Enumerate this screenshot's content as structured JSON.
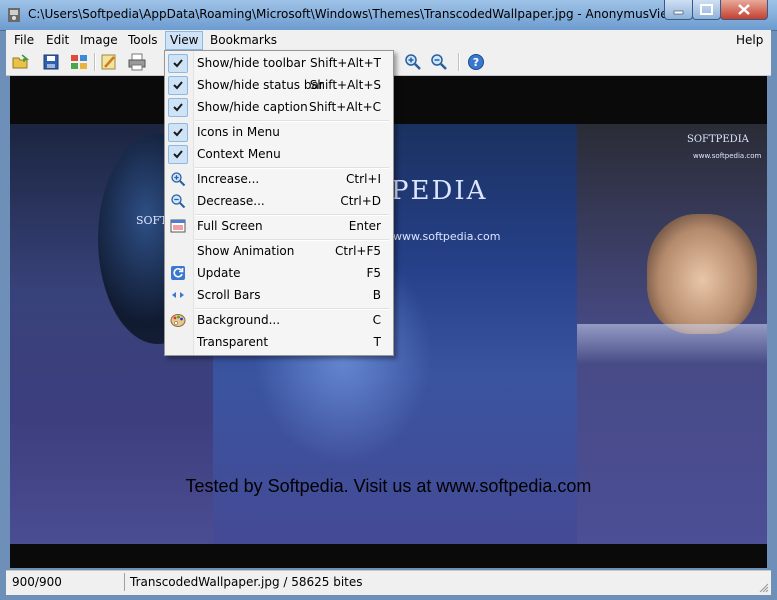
{
  "window": {
    "title": "C:\\Users\\Softpedia\\AppData\\Roaming\\Microsoft\\Windows\\Themes\\TranscodedWallpaper.jpg - AnonymusViewer"
  },
  "menubar": {
    "file": "File",
    "edit": "Edit",
    "image": "Image",
    "tools": "Tools",
    "view": "View",
    "bookmarks": "Bookmarks",
    "help": "Help"
  },
  "view_menu": {
    "items": [
      {
        "label": "Show/hide toolbar",
        "shortcut": "Shift+Alt+T",
        "checked": true
      },
      {
        "label": "Show/hide status bar",
        "shortcut": "Shift+Alt+S",
        "checked": true
      },
      {
        "label": "Show/hide caption",
        "shortcut": "Shift+Alt+C",
        "checked": true
      },
      {
        "label": "Icons in Menu",
        "shortcut": "",
        "checked": true
      },
      {
        "label": "Context Menu",
        "shortcut": "",
        "checked": true
      },
      {
        "label": "Increase...",
        "shortcut": "Ctrl+I",
        "icon": "zoom-in-icon"
      },
      {
        "label": "Decrease...",
        "shortcut": "Ctrl+D",
        "icon": "zoom-out-icon"
      },
      {
        "label": "Full Screen",
        "shortcut": "Enter",
        "icon": "fullscreen-icon"
      },
      {
        "label": "Show Animation",
        "shortcut": "Ctrl+F5"
      },
      {
        "label": "Update",
        "shortcut": "F5",
        "icon": "refresh-icon"
      },
      {
        "label": "Scroll Bars",
        "shortcut": "B",
        "icon": "scroll-arrows-icon"
      },
      {
        "label": "Background...",
        "shortcut": "C",
        "icon": "palette-icon"
      },
      {
        "label": "Transparent",
        "shortcut": "T"
      }
    ]
  },
  "image": {
    "banner_text": "SOFTPEDIA",
    "website": "www.softpedia.com",
    "big_text": "PEDIA",
    "watermark_caption": "Tested by Softpedia. Visit us at www.softpedia.com"
  },
  "statusbar": {
    "dimensions": "900/900",
    "file_info": "TranscodedWallpaper.jpg / 58625 bites"
  },
  "colors": {
    "accent": "#cfe3f7",
    "accent_border": "#8fb7e0",
    "titlebar": "#6d9cd0"
  }
}
